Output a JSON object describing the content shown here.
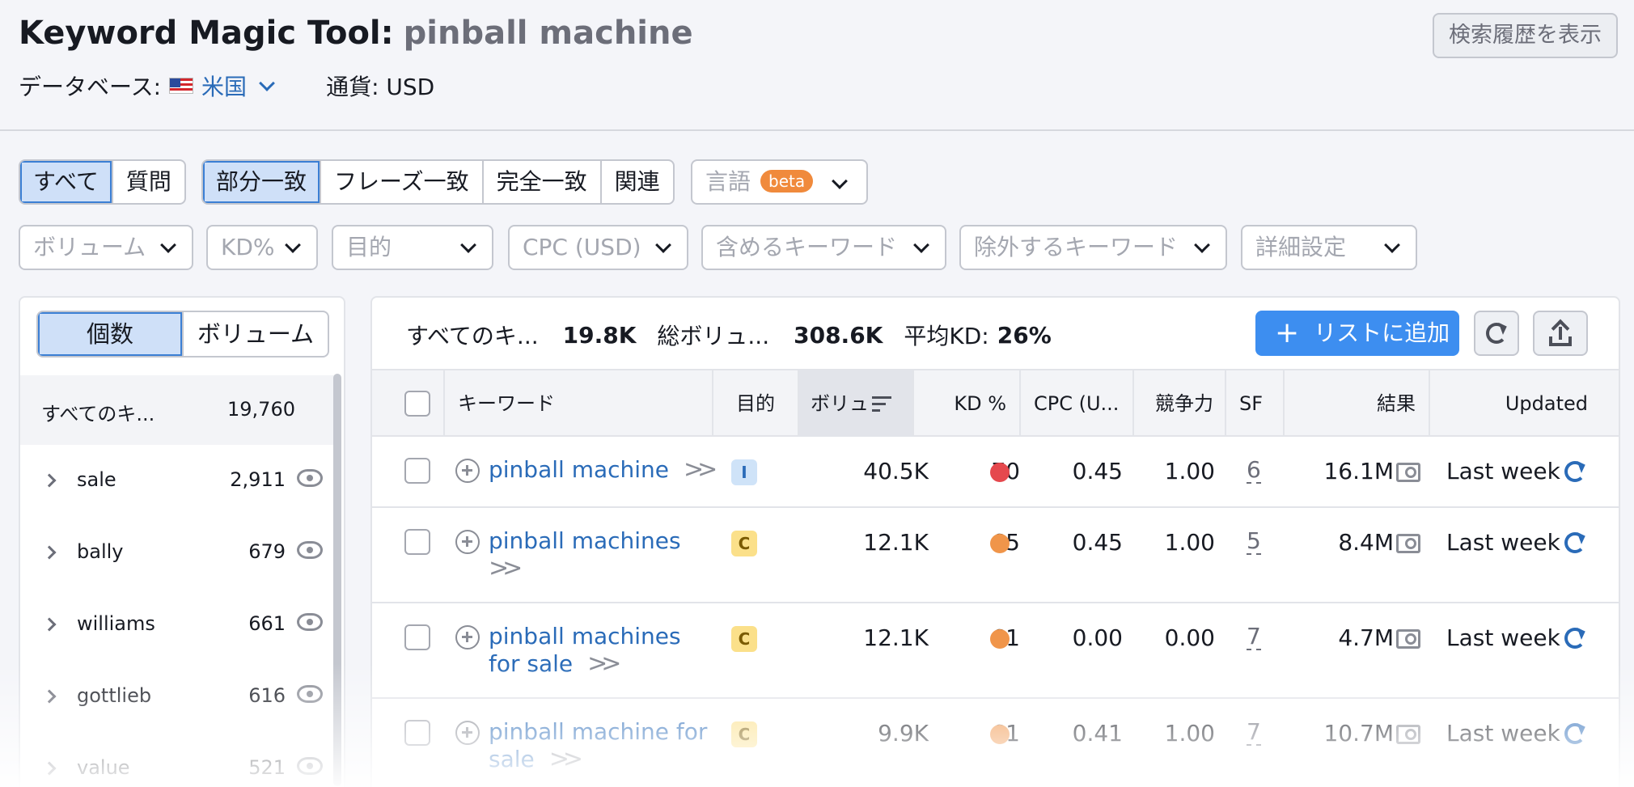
{
  "header": {
    "title_label": "Keyword Magic Tool:",
    "query": "pinball machine",
    "history_button": "検索履歴を表示",
    "database_label": "データベース:",
    "database_country": "米国",
    "currency": "通貨: USD"
  },
  "match_tabs": {
    "all": "すべて",
    "questions": "質問",
    "broad": "部分一致",
    "phrase": "フレーズ一致",
    "exact": "完全一致",
    "related": "関連"
  },
  "language": {
    "label": "言語",
    "badge": "beta"
  },
  "filters": {
    "volume": "ボリューム",
    "kd": "KD%",
    "intent": "目的",
    "cpc": "CPC (USD)",
    "include": "含めるキーワード",
    "exclude": "除外するキーワード",
    "advanced": "詳細設定"
  },
  "groups_panel": {
    "toggle_count": "個数",
    "toggle_volume": "ボリューム",
    "all_label": "すべてのキ...",
    "all_count": "19,760",
    "items": [
      {
        "name": "sale",
        "count": "2,911"
      },
      {
        "name": "bally",
        "count": "679"
      },
      {
        "name": "williams",
        "count": "661"
      },
      {
        "name": "gottlieb",
        "count": "616"
      },
      {
        "name": "value",
        "count": "521"
      }
    ]
  },
  "summary": {
    "all_keywords_label": "すべてのキ...",
    "all_keywords_value": "19.8K",
    "total_volume_label": "総ボリュ...",
    "total_volume_value": "308.6K",
    "avg_kd_label": "平均KD:",
    "avg_kd_value": "26%",
    "add_to_list": "リストに追加"
  },
  "table": {
    "headers": {
      "keyword": "キーワード",
      "intent": "目的",
      "volume": "ボリュ",
      "kd": "KD %",
      "cpc": "CPC (U...",
      "competition": "競争力",
      "sf": "SF",
      "results": "結果",
      "updated": "Updated"
    },
    "rows": [
      {
        "keyword_lines": [
          "pinball machine"
        ],
        "intent": "I",
        "volume": "40.5K",
        "kd": "70",
        "cpc": "0.45",
        "competition": "1.00",
        "sf": "6",
        "results": "16.1M",
        "updated": "Last week"
      },
      {
        "keyword_lines": [
          "pinball machines"
        ],
        "intent": "C",
        "volume": "12.1K",
        "kd": "65",
        "cpc": "0.45",
        "competition": "1.00",
        "sf": "5",
        "results": "8.4M",
        "updated": "Last week"
      },
      {
        "keyword_lines": [
          "pinball machines",
          "for sale"
        ],
        "intent": "C",
        "volume": "12.1K",
        "kd": "61",
        "cpc": "0.00",
        "competition": "0.00",
        "sf": "7",
        "results": "4.7M",
        "updated": "Last week"
      },
      {
        "keyword_lines": [
          "pinball machine for",
          "sale"
        ],
        "intent": "C",
        "volume": "9.9K",
        "kd": "61",
        "cpc": "0.41",
        "competition": "1.00",
        "sf": "7",
        "results": "10.7M",
        "updated": "Last week"
      }
    ]
  },
  "colors": {
    "accent_blue": "#3d8ef0",
    "link_blue": "#2a6bb8",
    "kd_hard": "#e5484d",
    "kd_medium": "#f0954a",
    "intent_informational_bg": "#cfe3f8",
    "intent_commercial_bg": "#fbe08a"
  }
}
